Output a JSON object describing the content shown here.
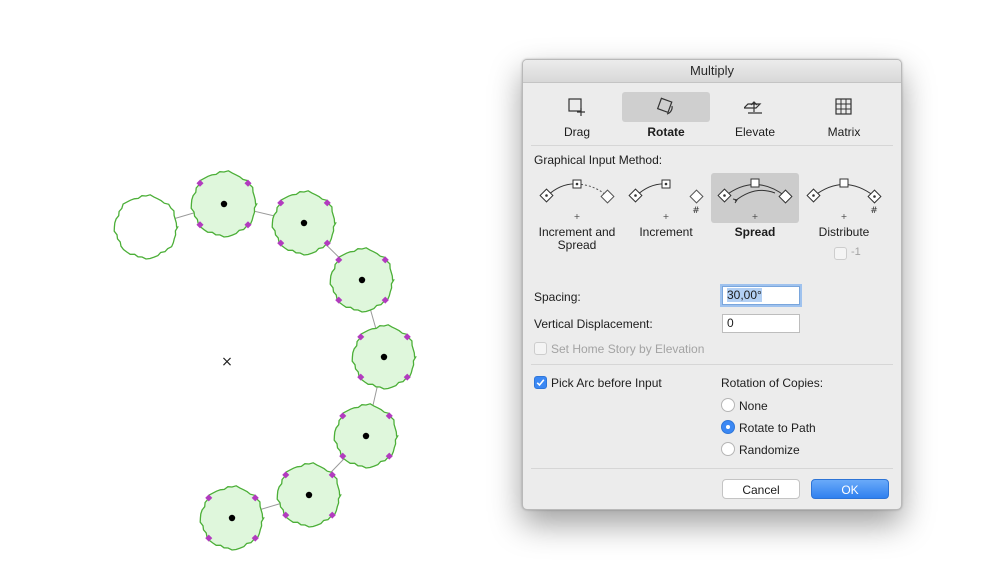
{
  "dialog": {
    "title": "Multiply",
    "tabs": [
      {
        "label": "Drag",
        "icon": "drag-icon"
      },
      {
        "label": "Rotate",
        "icon": "rotate-icon",
        "selected": true
      },
      {
        "label": "Elevate",
        "icon": "elevate-icon"
      },
      {
        "label": "Matrix",
        "icon": "matrix-icon"
      }
    ],
    "graphical_input_label": "Graphical Input Method:",
    "methods": [
      {
        "label": "Increment and Spread",
        "line1": "Increment and",
        "line2": "Spread"
      },
      {
        "label": "Increment"
      },
      {
        "label": "Spread",
        "selected": true
      },
      {
        "label": "Distribute"
      }
    ],
    "distribute_option": {
      "label": "-1",
      "checked": false,
      "enabled": false
    },
    "spacing": {
      "label": "Spacing:",
      "value": "30,00°"
    },
    "vertical_displacement": {
      "label": "Vertical Displacement:",
      "value": "0"
    },
    "home_story": {
      "label": "Set Home Story by Elevation",
      "checked": false,
      "enabled": false
    },
    "pick_arc": {
      "label": "Pick Arc before Input",
      "checked": true
    },
    "rotation_of_copies": {
      "label": "Rotation of Copies:",
      "options": [
        {
          "label": "None",
          "selected": false
        },
        {
          "label": "Rotate to Path",
          "selected": true
        },
        {
          "label": "Randomize",
          "selected": false
        }
      ]
    },
    "buttons": {
      "cancel": "Cancel",
      "ok": "OK"
    }
  },
  "canvas": {
    "center_marker": "×",
    "tree_fill": "#dff7dc",
    "tree_stroke": "#4caf38",
    "handle_color": "#b23bbf",
    "path_color": "#9a9a9a",
    "original_tree_fill": "#ffffff"
  }
}
